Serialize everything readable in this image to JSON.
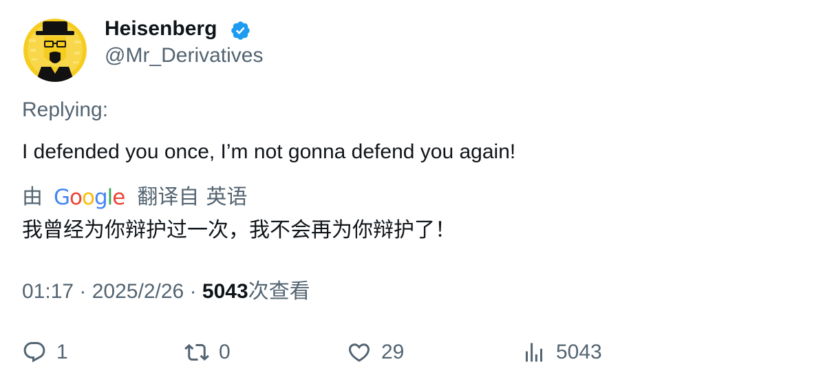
{
  "author": {
    "display_name": "Heisenberg",
    "handle": "@Mr_Derivatives",
    "verified": true,
    "verified_color": "#1d9bf0",
    "avatar_bg": "#f5cc1f"
  },
  "replying_label": "Replying:",
  "tweet_text": "I defended you once, I’m not gonna defend you again!",
  "translation": {
    "by_label": "由",
    "provider": "Google",
    "translated_from_label": "翻译自",
    "language": "英语",
    "text": "我曾经为你辩护过一次，我不会再为你辩护了！"
  },
  "meta": {
    "time": "01:17",
    "separator": "·",
    "date": "2025/2/26",
    "views_count": "5043",
    "views_label": "次查看"
  },
  "actions": {
    "reply_count": "1",
    "retweet_count": "0",
    "like_count": "29",
    "views_count": "5043"
  },
  "icons": {
    "reply": "reply-icon",
    "retweet": "retweet-icon",
    "like": "heart-icon",
    "views": "analytics-icon",
    "verified": "verified-badge-icon"
  },
  "colors": {
    "text_primary": "#0f1419",
    "text_secondary": "#536471",
    "google_blue": "#4285F4",
    "google_red": "#EA4335",
    "google_yellow": "#FBBC05",
    "google_green": "#34A853"
  }
}
